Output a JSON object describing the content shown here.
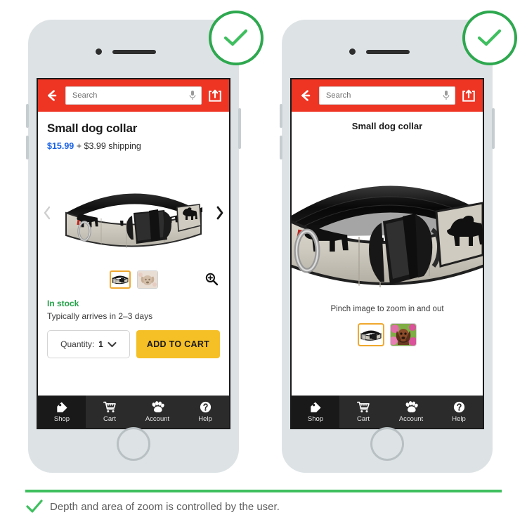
{
  "page": {
    "caption": "Depth and area of zoom is controlled by the user.",
    "accent_green": "#3fbf5f",
    "brand_red": "#ee3524",
    "cta_yellow": "#f5bf26",
    "price_blue": "#1560e8",
    "selected_thumb_border": "#f0a82e"
  },
  "badges": [
    {
      "name": "approved-check-left",
      "glyph": "check"
    },
    {
      "name": "approved-check-right",
      "glyph": "check"
    }
  ],
  "phone_left": {
    "appbar": {
      "back_label": "Back",
      "search_placeholder": "Search",
      "search_value": "",
      "mic_label": "Voice search",
      "share_label": "Share"
    },
    "product": {
      "title": "Small dog collar",
      "price": "$15.99",
      "shipping": "+ $3.99 shipping",
      "stock": "In stock",
      "eta": "Typically arrives in 2–3 days"
    },
    "carousel": {
      "prev_label": "‹",
      "next_label": "›",
      "zoom_label": "Zoom in"
    },
    "thumbnails": [
      {
        "name": "thumbnail-collar",
        "selected": true
      },
      {
        "name": "thumbnail-dog",
        "selected": false
      }
    ],
    "purchase": {
      "quantity_label": "Quantity:",
      "quantity_value": "1",
      "add_to_cart": "ADD TO CART"
    },
    "tabs": [
      {
        "label": "Shop",
        "icon": "tag-icon",
        "active": true
      },
      {
        "label": "Cart",
        "icon": "cart-icon",
        "active": false
      },
      {
        "label": "Account",
        "icon": "paw-icon",
        "active": false
      },
      {
        "label": "Help",
        "icon": "question-circle-icon",
        "active": false
      }
    ]
  },
  "phone_right": {
    "appbar": {
      "back_label": "Back",
      "search_placeholder": "Search",
      "search_value": "",
      "mic_label": "Voice search",
      "share_label": "Share"
    },
    "product": {
      "title": "Small dog collar",
      "hint": "Pinch image to zoom in and out"
    },
    "thumbnails": [
      {
        "name": "thumbnail-collar",
        "selected": true
      },
      {
        "name": "thumbnail-dog",
        "selected": false
      }
    ],
    "tabs": [
      {
        "label": "Shop",
        "icon": "tag-icon",
        "active": true
      },
      {
        "label": "Cart",
        "icon": "cart-icon",
        "active": false
      },
      {
        "label": "Account",
        "icon": "paw-icon",
        "active": false
      },
      {
        "label": "Help",
        "icon": "question-circle-icon",
        "active": false
      }
    ]
  }
}
